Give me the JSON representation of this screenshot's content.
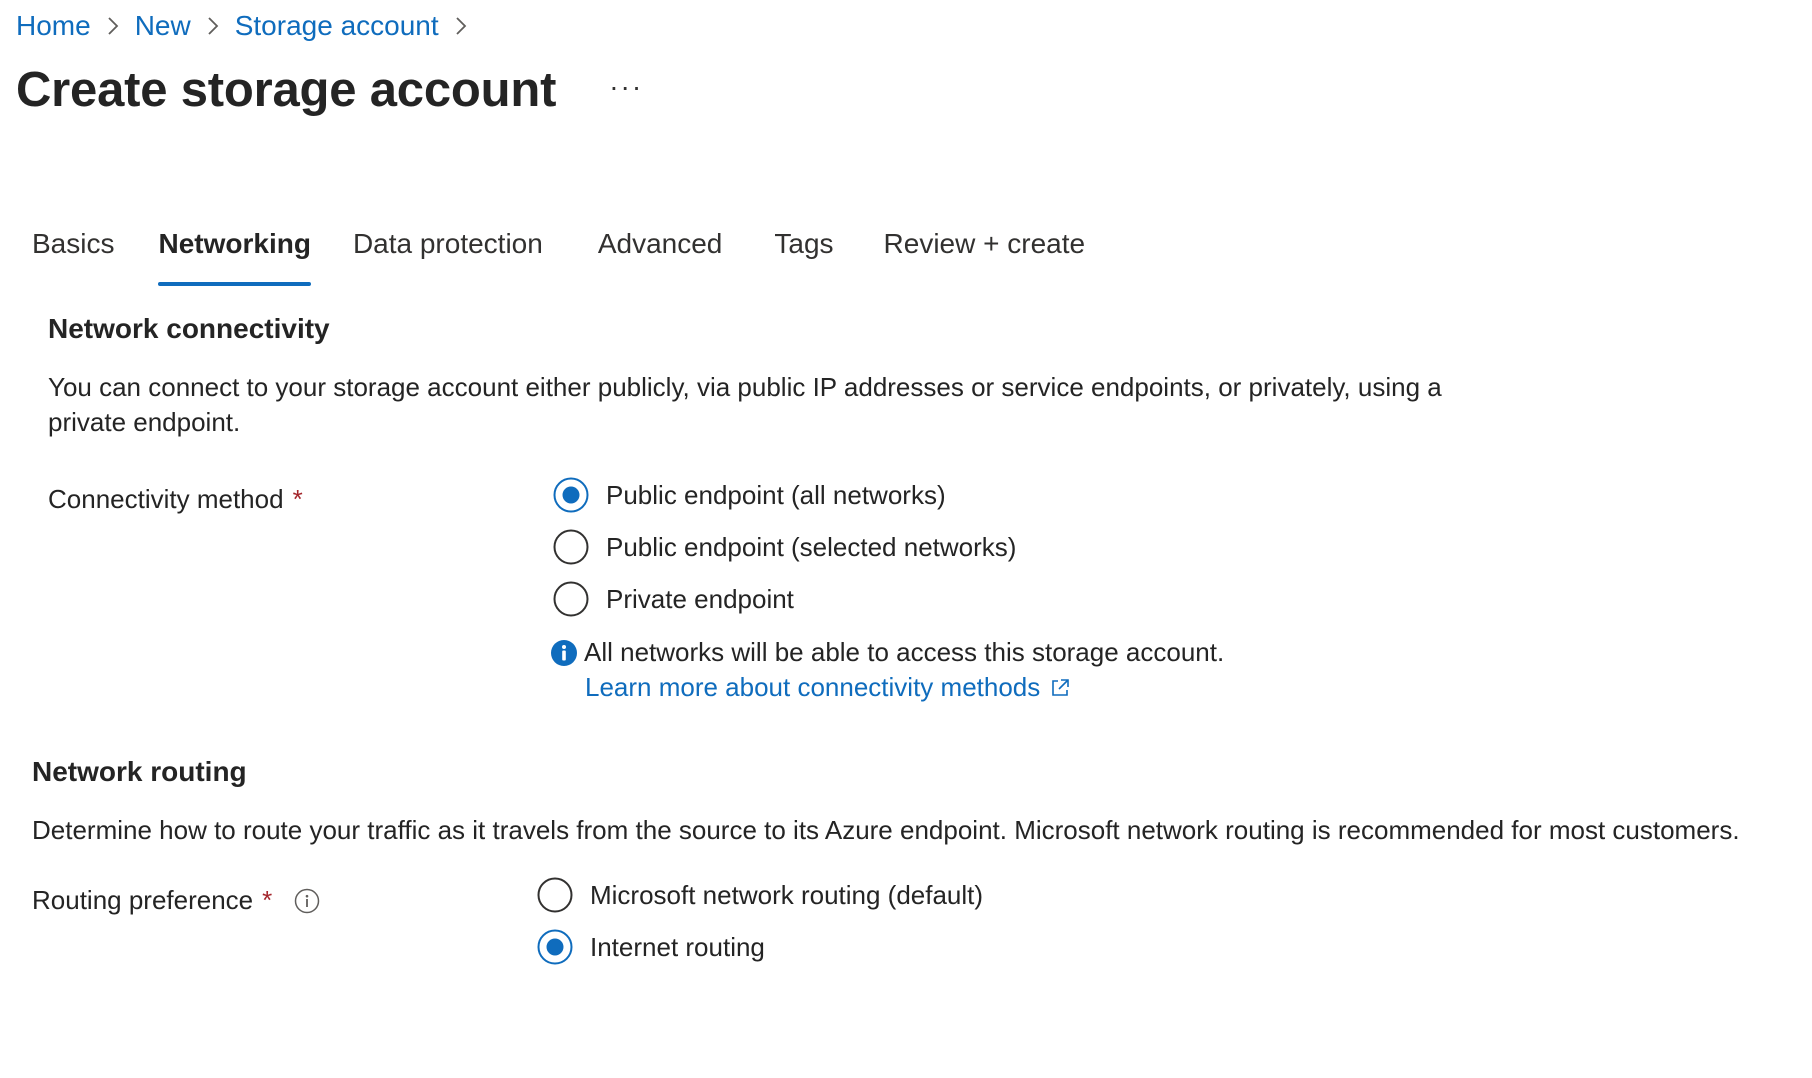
{
  "breadcrumb": {
    "home": "Home",
    "new": "New",
    "storage_account": "Storage account"
  },
  "page": {
    "title": "Create storage account",
    "more_label": "···"
  },
  "tabs": [
    {
      "label": "Basics",
      "active": false
    },
    {
      "label": "Networking",
      "active": true
    },
    {
      "label": "Data protection",
      "active": false
    },
    {
      "label": "Advanced",
      "active": false
    },
    {
      "label": "Tags",
      "active": false
    },
    {
      "label": "Review + create",
      "active": false
    }
  ],
  "network_connectivity": {
    "heading": "Network connectivity",
    "description": "You can connect to your storage account either publicly, via public IP addresses or service endpoints, or privately, using a private endpoint.",
    "connectivity_label": "Connectivity method",
    "required_marker": "*",
    "options": [
      {
        "label": "Public endpoint (all networks)",
        "selected": true
      },
      {
        "label": "Public endpoint (selected networks)",
        "selected": false
      },
      {
        "label": "Private endpoint",
        "selected": false
      }
    ],
    "info_message": "All networks will be able to access this storage account.",
    "learn_more": "Learn more about connectivity methods"
  },
  "network_routing": {
    "heading": "Network routing",
    "description": "Determine how to route your traffic as it travels from the source to its Azure endpoint. Microsoft network routing is recommended for most customers.",
    "routing_label": "Routing preference",
    "required_marker": "*",
    "options": [
      {
        "label": "Microsoft network routing (default)",
        "selected": false
      },
      {
        "label": "Internet routing",
        "selected": true
      }
    ]
  },
  "colors": {
    "accent": "#0f6cbd",
    "required": "#a4262c",
    "text": "#242424"
  },
  "icons": {
    "breadcrumb_separator": "chevron-right-icon",
    "more": "ellipsis-icon",
    "info_filled": "info-icon",
    "info_outline": "info-outline-icon",
    "external": "external-link-icon"
  }
}
